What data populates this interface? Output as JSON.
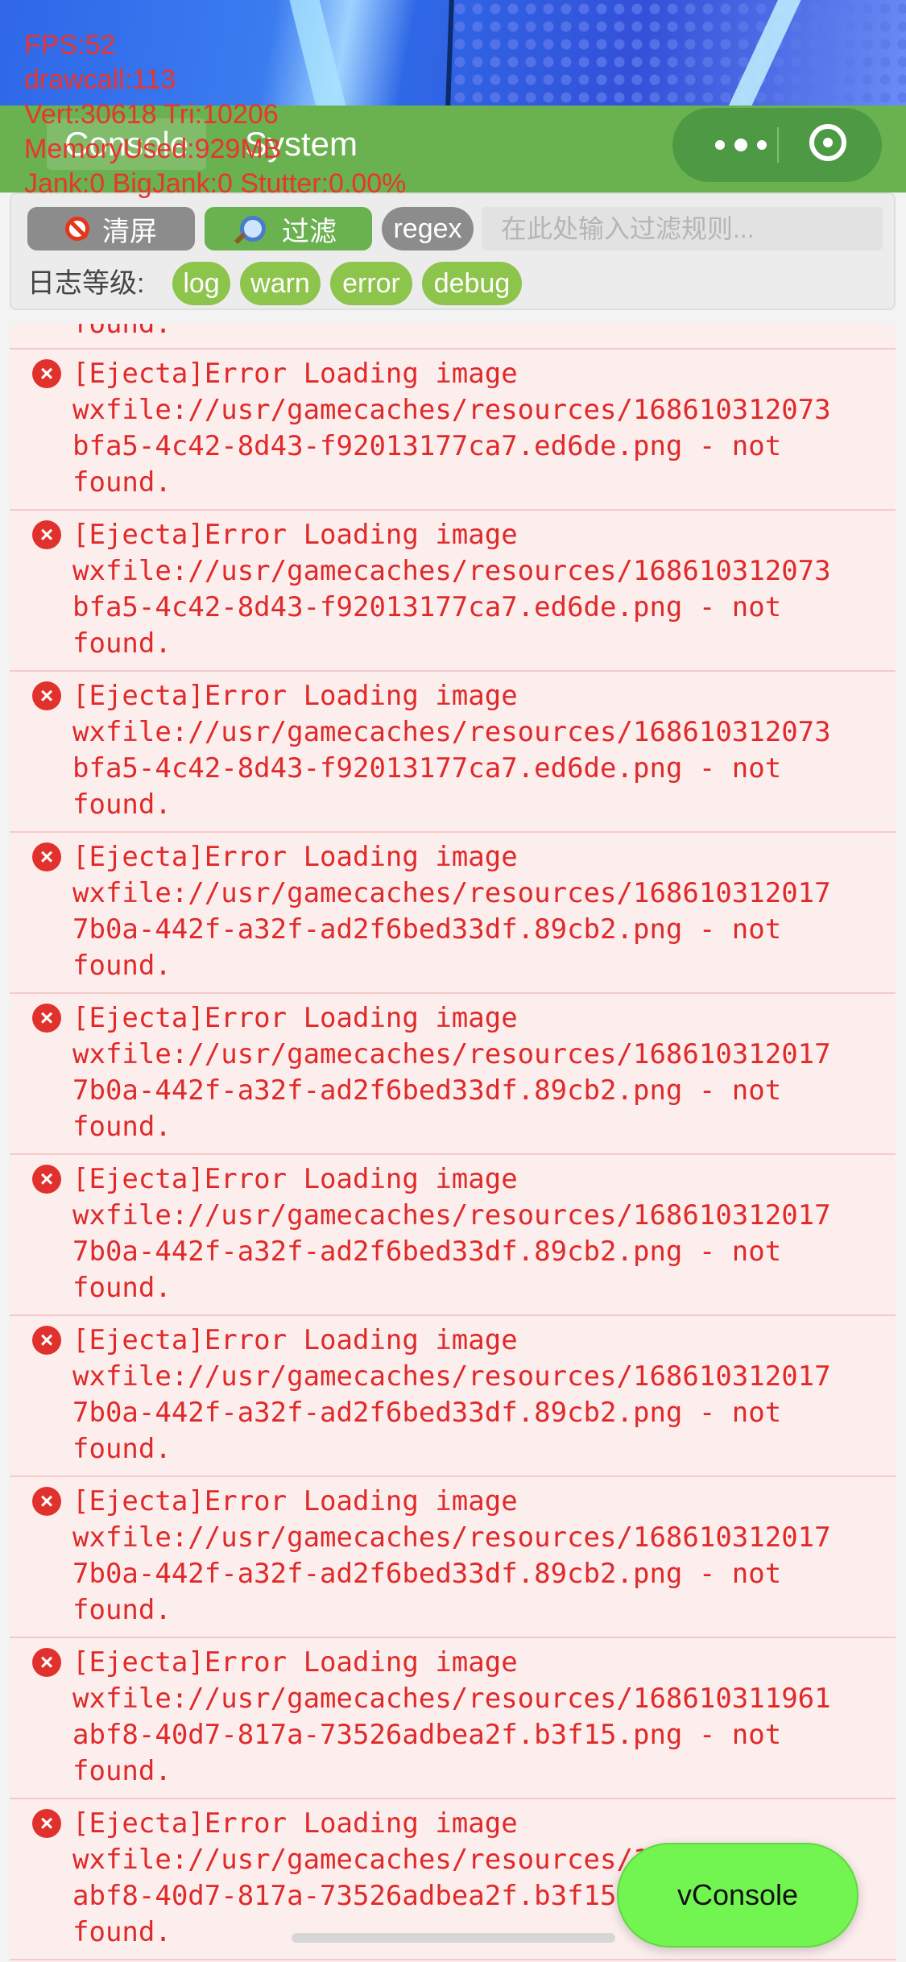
{
  "stats": {
    "fps": "FPS:52",
    "drawcall": "drawcall:113",
    "vert": "Vert:30618 Tri:10206",
    "memory": "MemoryUsed:929MB",
    "jank": "Jank:0 BigJank:0 Stutter:0.00%"
  },
  "header": {
    "tabs": [
      {
        "label": "Console"
      },
      {
        "label": "System"
      }
    ]
  },
  "toolbar": {
    "clear_label": "清屏",
    "filter_label": "过滤",
    "regex_label": "regex",
    "filter_placeholder": "在此处输入过滤规则...",
    "level_label": "日志等级:",
    "levels": [
      "log",
      "warn",
      "error",
      "debug"
    ]
  },
  "log": {
    "partial_text": "found.",
    "entries": [
      {
        "text": "[Ejecta]Error Loading image\nwxfile://usr/gamecaches/resources/168610312073\nbfa5-4c42-8d43-f92013177ca7.ed6de.png - not\nfound."
      },
      {
        "text": "[Ejecta]Error Loading image\nwxfile://usr/gamecaches/resources/168610312073\nbfa5-4c42-8d43-f92013177ca7.ed6de.png - not\nfound."
      },
      {
        "text": "[Ejecta]Error Loading image\nwxfile://usr/gamecaches/resources/168610312073\nbfa5-4c42-8d43-f92013177ca7.ed6de.png - not\nfound."
      },
      {
        "text": "[Ejecta]Error Loading image\nwxfile://usr/gamecaches/resources/168610312017\n7b0a-442f-a32f-ad2f6bed33df.89cb2.png - not\nfound."
      },
      {
        "text": "[Ejecta]Error Loading image\nwxfile://usr/gamecaches/resources/168610312017\n7b0a-442f-a32f-ad2f6bed33df.89cb2.png - not\nfound."
      },
      {
        "text": "[Ejecta]Error Loading image\nwxfile://usr/gamecaches/resources/168610312017\n7b0a-442f-a32f-ad2f6bed33df.89cb2.png - not\nfound."
      },
      {
        "text": "[Ejecta]Error Loading image\nwxfile://usr/gamecaches/resources/168610312017\n7b0a-442f-a32f-ad2f6bed33df.89cb2.png - not\nfound."
      },
      {
        "text": "[Ejecta]Error Loading image\nwxfile://usr/gamecaches/resources/168610312017\n7b0a-442f-a32f-ad2f6bed33df.89cb2.png - not\nfound."
      },
      {
        "text": "[Ejecta]Error Loading image\nwxfile://usr/gamecaches/resources/168610311961\nabf8-40d7-817a-73526adbea2f.b3f15.png - not\nfound."
      },
      {
        "text": "[Ejecta]Error Loading image\nwxfile://usr/gamecaches/resources/168610311961\nabf8-40d7-817a-73526adbea2f.b3f15.png - not\nfound."
      }
    ]
  },
  "vconsole_button": "vConsole",
  "colors": {
    "header_green": "#6ab150",
    "level_green": "#8dc44c",
    "error_red": "#e02a2a",
    "log_bg": "#fdeeee",
    "vconsole_green": "#72f551"
  }
}
